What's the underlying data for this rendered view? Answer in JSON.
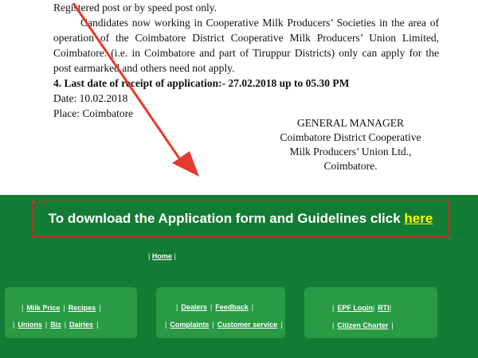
{
  "document": {
    "lines": [
      {
        "text": "Registered post or by speed post only."
      },
      {
        "text": "Candidates now working in Cooperative Milk Producers’ Societies in the area of operation of the Coimbatore District Cooperative Milk Producers’ Union Limited, Coimbatore. (i.e. in Coimbatore and part of Tiruppur Districts) only can apply for the post earmarked and others need not apply."
      },
      {
        "text": "4. Last date of receipt of application:- 27.02.2018 up to 05.30 PM"
      },
      {
        "text": "Date: 10.02.2018"
      },
      {
        "text": "Place: Coimbatore"
      }
    ],
    "signature": {
      "title": "GENERAL MANAGER",
      "org1": "Coimbatore District Cooperative",
      "org2": "Milk Producers’ Union Ltd.,",
      "city": "Coimbatore."
    }
  },
  "download": {
    "text": "To download the Application form and Guidelines click ",
    "link": "here"
  },
  "nav": {
    "home": "Home",
    "sep": "|",
    "panel1": {
      "row1": [
        "Milk Price",
        "Recipes"
      ],
      "row2": [
        "Unions",
        "Biz",
        "Dairies"
      ]
    },
    "panel2": {
      "row1": [
        "Dealers",
        "Feedback"
      ],
      "row2": [
        "Complaints",
        "Customer service"
      ]
    },
    "panel3": {
      "row1": [
        "EPF Login",
        "RTI"
      ],
      "row2": [
        "Citizen Charter"
      ]
    }
  },
  "colors": {
    "background": "#127c34",
    "panel": "#2a9a45",
    "border": "#a23d2d",
    "link_highlight": "#ffff00",
    "arrow": "#e8392e"
  },
  "icons": [
    "arrow-annotation-icon"
  ]
}
